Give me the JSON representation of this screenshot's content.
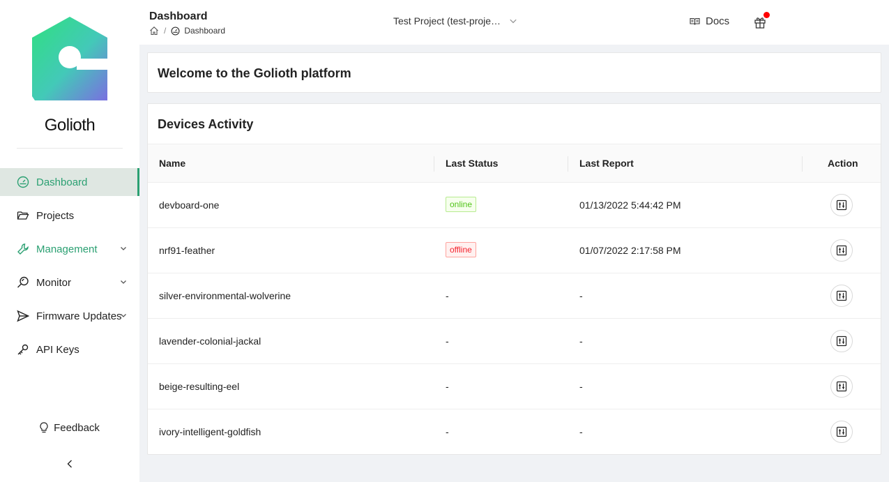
{
  "brand": {
    "name": "Golioth",
    "accent": "#2ba072"
  },
  "sidebar": {
    "items": [
      {
        "label": "Dashboard",
        "icon": "dashboard-icon",
        "active": true
      },
      {
        "label": "Projects",
        "icon": "folder-open-icon"
      },
      {
        "label": "Management",
        "icon": "wrench-icon",
        "expandable": true
      },
      {
        "label": "Monitor",
        "icon": "monitor-search-icon",
        "expandable": true
      },
      {
        "label": "Firmware Updates",
        "icon": "send-icon",
        "expandable": true
      },
      {
        "label": "API Keys",
        "icon": "key-icon"
      }
    ],
    "feedback_label": "Feedback"
  },
  "header": {
    "title": "Dashboard",
    "breadcrumb": {
      "current": "Dashboard",
      "separator": "/"
    },
    "project_selector": "Test Project (test-proje…",
    "docs_label": "Docs"
  },
  "welcome": {
    "title": "Welcome to the Golioth platform"
  },
  "devices": {
    "title": "Devices Activity",
    "columns": [
      "Name",
      "Last Status",
      "Last Report",
      "Action"
    ],
    "rows": [
      {
        "name": "devboard-one",
        "status": "online",
        "last_report": "01/13/2022 5:44:42 PM"
      },
      {
        "name": "nrf91-feather",
        "status": "offline",
        "last_report": "01/07/2022 2:17:58 PM"
      },
      {
        "name": "silver-environmental-wolverine",
        "status": "-",
        "last_report": "-"
      },
      {
        "name": "lavender-colonial-jackal",
        "status": "-",
        "last_report": "-"
      },
      {
        "name": "beige-resulting-eel",
        "status": "-",
        "last_report": "-"
      },
      {
        "name": "ivory-intelligent-goldfish",
        "status": "-",
        "last_report": "-"
      }
    ]
  }
}
